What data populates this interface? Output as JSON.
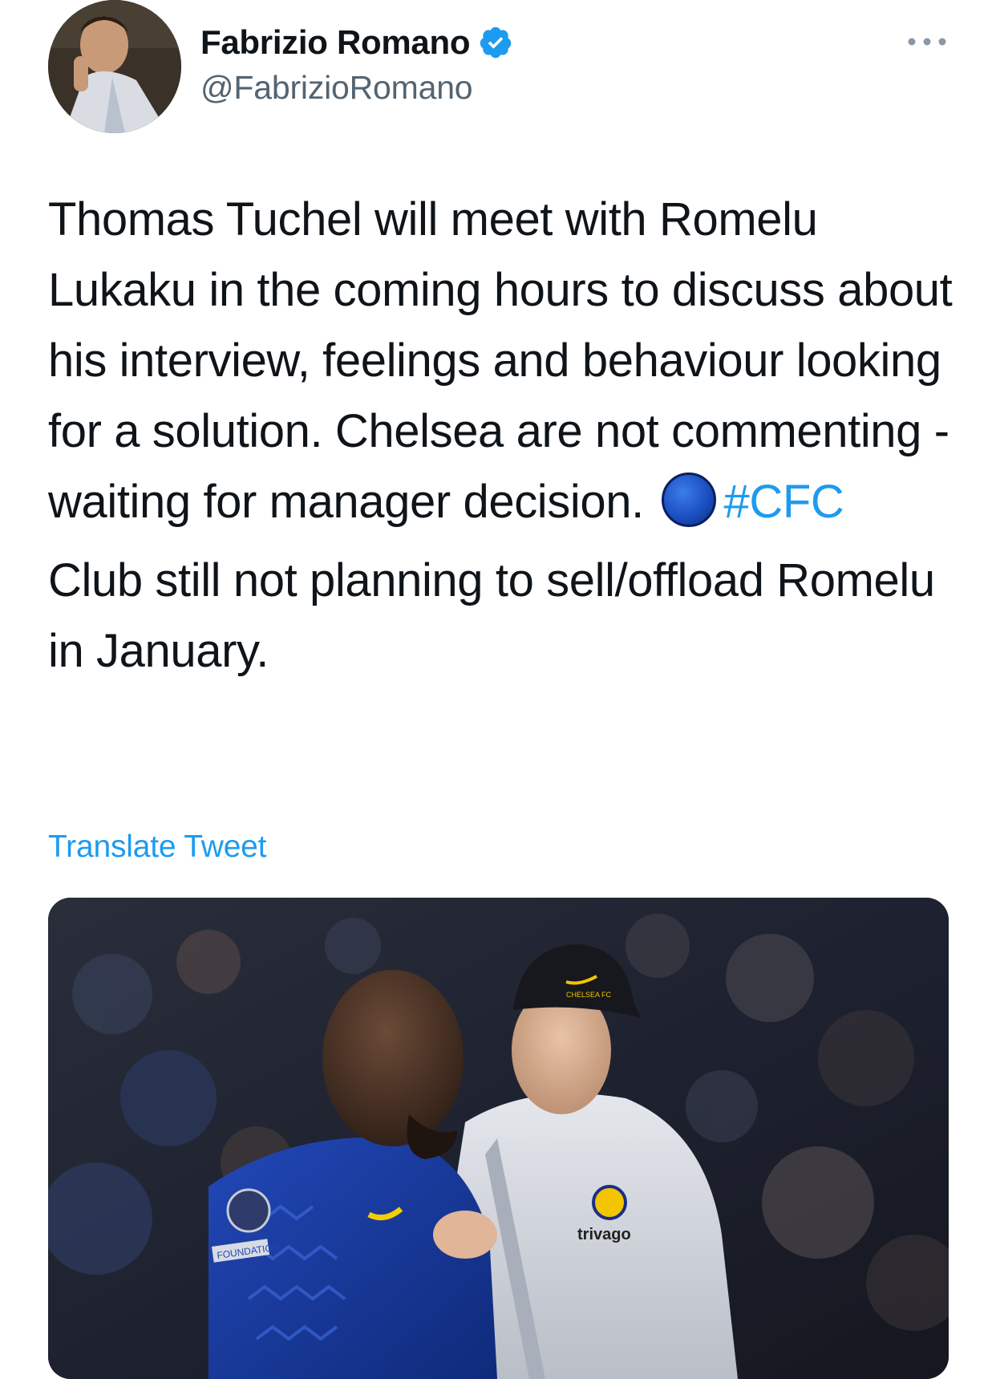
{
  "author": {
    "display_name": "Fabrizio Romano",
    "handle": "@FabrizioRomano",
    "verified": true,
    "verified_icon": "verified-badge-icon",
    "avatar_icon": "avatar"
  },
  "menu": {
    "icon": "more-options-icon"
  },
  "tweet": {
    "paragraph1": "Thomas Tuchel will meet with Romelu Lukaku in the coming hours to discuss about his interview, feelings and behaviour looking for a solution. Chelsea are not commenting - waiting for manager decision.",
    "emoji": "blue-circle-emoji",
    "hashtag": "#CFC",
    "paragraph2": "Club still not planning to sell/offload Romelu in January."
  },
  "translate_label": "Translate Tweet",
  "media": {
    "jacket_text": "trivago",
    "cap_text": "CHELSEA FC",
    "sleeve_patch_text": "FOUNDATION"
  },
  "colors": {
    "link": "#1d9bf0",
    "secondary_text": "#536471",
    "primary_text": "#0f1419"
  }
}
